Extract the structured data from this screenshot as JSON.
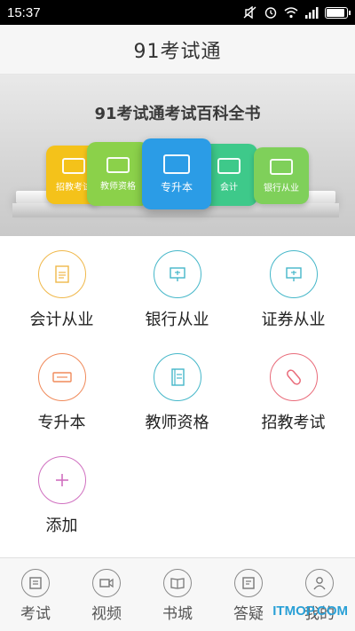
{
  "status_bar": {
    "time": "15:37",
    "battery_level": 0.9
  },
  "header": {
    "title": "91考试通"
  },
  "banner": {
    "title": "91考试通考试百科全书",
    "books": [
      {
        "label": "招教考试",
        "color": "#f4c21a"
      },
      {
        "label": "教师资格",
        "color": "#8bd14a"
      },
      {
        "label": "专升本",
        "color": "#2b9ce6"
      },
      {
        "label": "会计",
        "color": "#3ec98a"
      },
      {
        "label": "银行从业",
        "color": "#7fd05a"
      }
    ]
  },
  "categories": [
    {
      "label": "会计从业",
      "icon": "document-icon",
      "color": "#f0b84a"
    },
    {
      "label": "银行从业",
      "icon": "presentation-board-icon",
      "color": "#45b7c9"
    },
    {
      "label": "证券从业",
      "icon": "presentation-board-icon",
      "color": "#45b7c9"
    },
    {
      "label": "专升本",
      "icon": "ticket-icon",
      "color": "#f08a5a"
    },
    {
      "label": "教师资格",
      "icon": "notebook-icon",
      "color": "#45b7c9"
    },
    {
      "label": "招教考试",
      "icon": "eraser-icon",
      "color": "#e96b7a"
    },
    {
      "label": "添加",
      "icon": "plus-icon",
      "color": "#d070c0"
    }
  ],
  "bottom_nav": [
    {
      "label": "考试",
      "icon": "exam-icon"
    },
    {
      "label": "视频",
      "icon": "video-icon"
    },
    {
      "label": "书城",
      "icon": "book-icon"
    },
    {
      "label": "答疑",
      "icon": "qa-icon"
    },
    {
      "label": "我的",
      "icon": "user-icon"
    }
  ],
  "watermark": "ITMOP.COM"
}
